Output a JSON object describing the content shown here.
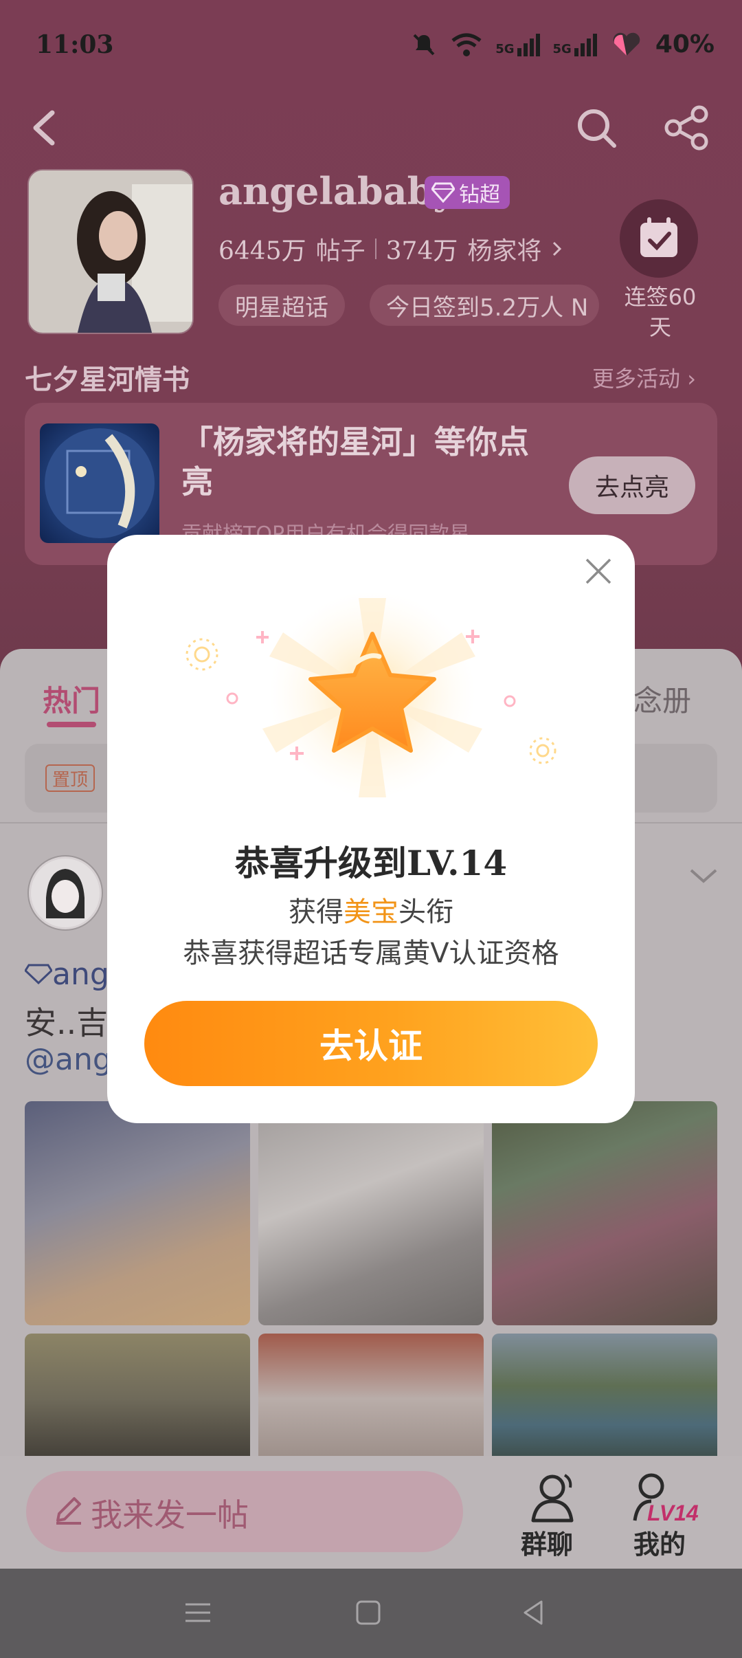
{
  "status_bar": {
    "time": "11:03",
    "battery": "40%",
    "network_1": "5G",
    "network_2": "5G"
  },
  "profile": {
    "name": "angelababy",
    "badge": "钻超",
    "posts_count": "6445万",
    "posts_label": "帖子",
    "fans_count": "374万",
    "fans_label": "杨家将",
    "tag_category": "明星超话",
    "tag_checkin": "今日签到5.2万人 N",
    "checkin_streak": "连签60天"
  },
  "activity": {
    "section_title": "七夕星河情书",
    "more": "更多活动",
    "card_title": "「杨家将的星河」等你点亮",
    "card_subtitle": "贡献榜TOP用户有机会得同款星",
    "card_button": "去点亮"
  },
  "feed": {
    "tab_hot": "热门",
    "tab_memo": "纪念册",
    "pinned_label": "置顶",
    "post_line1": "ang",
    "post_line2": "安..吉",
    "post_line3": "@ange"
  },
  "bottom_bar": {
    "compose_placeholder": "我来发一帖",
    "group_chat": "群聊",
    "mine": "我的",
    "level_badge": "LV14"
  },
  "modal": {
    "title": "恭喜升级到LV.14",
    "line1_prefix": "获得",
    "line1_highlight": "美宝",
    "line1_suffix": "头衔",
    "line2": "恭喜获得超话专属黄V认证资格",
    "button": "去认证"
  },
  "colors": {
    "accent": "#b24d72",
    "button_orange": "#ff9a18",
    "highlight": "#f29418"
  }
}
